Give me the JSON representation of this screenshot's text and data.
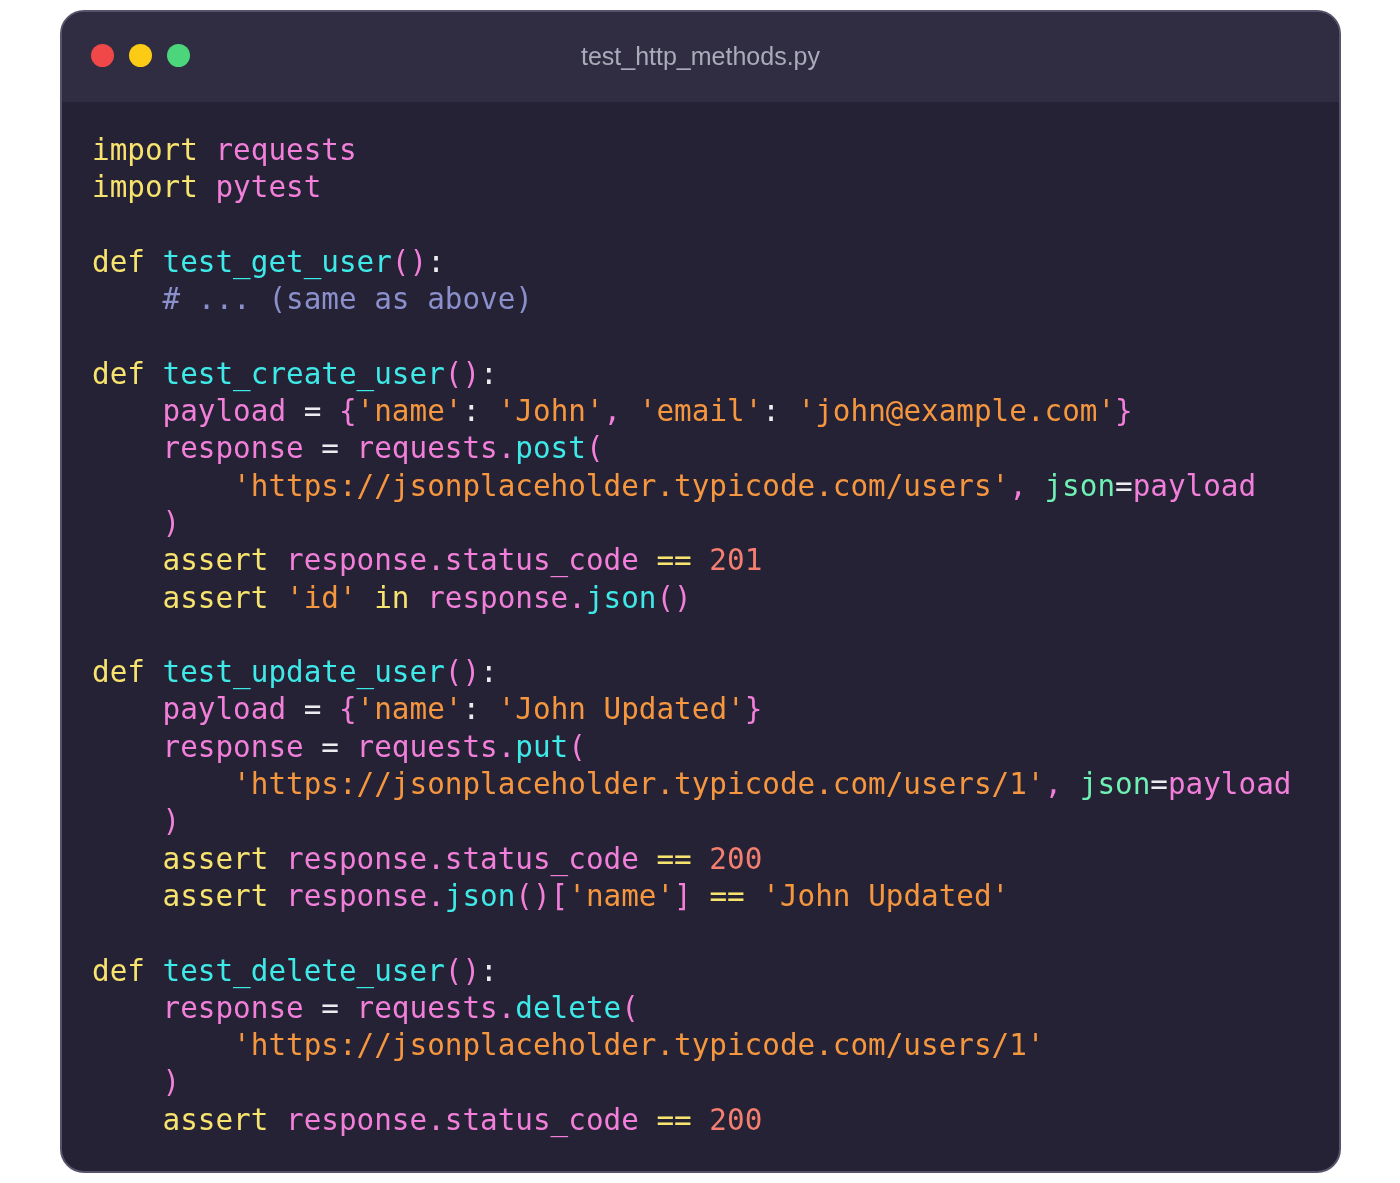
{
  "window": {
    "title": "test_http_methods.py"
  },
  "code_lines": [
    {
      "kind": "code",
      "tokens": [
        {
          "kind": "keyword",
          "text": "import "
        },
        {
          "kind": "ident",
          "text": "requests"
        }
      ]
    },
    {
      "kind": "code",
      "tokens": [
        {
          "kind": "keyword",
          "text": "import "
        },
        {
          "kind": "ident",
          "text": "pytest"
        }
      ]
    },
    {
      "kind": "blank"
    },
    {
      "kind": "code",
      "tokens": [
        {
          "kind": "keyword",
          "text": "def "
        },
        {
          "kind": "func",
          "text": "test_get_user"
        },
        {
          "kind": "paren",
          "text": "()"
        },
        {
          "kind": "punct",
          "text": ":"
        }
      ]
    },
    {
      "kind": "code",
      "tokens": [
        {
          "kind": "comment",
          "text": "    # ... (same as above)"
        }
      ]
    },
    {
      "kind": "blank"
    },
    {
      "kind": "code",
      "tokens": [
        {
          "kind": "keyword",
          "text": "def "
        },
        {
          "kind": "func",
          "text": "test_create_user"
        },
        {
          "kind": "paren",
          "text": "()"
        },
        {
          "kind": "punct",
          "text": ":"
        }
      ]
    },
    {
      "kind": "code",
      "tokens": [
        {
          "kind": "ident",
          "text": "    payload"
        },
        {
          "kind": "punct",
          "text": " = "
        },
        {
          "kind": "paren",
          "text": "{"
        },
        {
          "kind": "string",
          "text": "'name'"
        },
        {
          "kind": "punct",
          "text": ": "
        },
        {
          "kind": "string",
          "text": "'John'"
        },
        {
          "kind": "paren",
          "text": ", "
        },
        {
          "kind": "string",
          "text": "'email'"
        },
        {
          "kind": "punct",
          "text": ": "
        },
        {
          "kind": "string",
          "text": "'john@example.com'"
        },
        {
          "kind": "paren",
          "text": "}"
        }
      ]
    },
    {
      "kind": "code",
      "tokens": [
        {
          "kind": "ident",
          "text": "    response"
        },
        {
          "kind": "punct",
          "text": " = "
        },
        {
          "kind": "ident",
          "text": "requests."
        },
        {
          "kind": "func",
          "text": "post"
        },
        {
          "kind": "paren",
          "text": "("
        }
      ]
    },
    {
      "kind": "code",
      "tokens": [
        {
          "kind": "string",
          "text": "        'https://jsonplaceholder.typicode.com/users'"
        },
        {
          "kind": "paren",
          "text": ", "
        },
        {
          "kind": "param",
          "text": "json"
        },
        {
          "kind": "punct",
          "text": "="
        },
        {
          "kind": "ident",
          "text": "payload"
        }
      ]
    },
    {
      "kind": "code",
      "tokens": [
        {
          "kind": "paren",
          "text": "    )"
        }
      ]
    },
    {
      "kind": "code",
      "tokens": [
        {
          "kind": "keyword",
          "text": "    assert "
        },
        {
          "kind": "ident",
          "text": "response.status_code "
        },
        {
          "kind": "operator",
          "text": "=="
        },
        {
          "kind": "number",
          "text": " 201"
        }
      ]
    },
    {
      "kind": "code",
      "tokens": [
        {
          "kind": "keyword",
          "text": "    assert "
        },
        {
          "kind": "string",
          "text": "'id'"
        },
        {
          "kind": "keyword",
          "text": " in "
        },
        {
          "kind": "ident",
          "text": "response."
        },
        {
          "kind": "func",
          "text": "json"
        },
        {
          "kind": "paren",
          "text": "()"
        }
      ]
    },
    {
      "kind": "blank"
    },
    {
      "kind": "code",
      "tokens": [
        {
          "kind": "keyword",
          "text": "def "
        },
        {
          "kind": "func",
          "text": "test_update_user"
        },
        {
          "kind": "paren",
          "text": "()"
        },
        {
          "kind": "punct",
          "text": ":"
        }
      ]
    },
    {
      "kind": "code",
      "tokens": [
        {
          "kind": "ident",
          "text": "    payload"
        },
        {
          "kind": "punct",
          "text": " = "
        },
        {
          "kind": "paren",
          "text": "{"
        },
        {
          "kind": "string",
          "text": "'name'"
        },
        {
          "kind": "punct",
          "text": ": "
        },
        {
          "kind": "string",
          "text": "'John Updated'"
        },
        {
          "kind": "paren",
          "text": "}"
        }
      ]
    },
    {
      "kind": "code",
      "tokens": [
        {
          "kind": "ident",
          "text": "    response"
        },
        {
          "kind": "punct",
          "text": " = "
        },
        {
          "kind": "ident",
          "text": "requests."
        },
        {
          "kind": "func",
          "text": "put"
        },
        {
          "kind": "paren",
          "text": "("
        }
      ]
    },
    {
      "kind": "code",
      "tokens": [
        {
          "kind": "string",
          "text": "        'https://jsonplaceholder.typicode.com/users/1'"
        },
        {
          "kind": "paren",
          "text": ", "
        },
        {
          "kind": "param",
          "text": "json"
        },
        {
          "kind": "punct",
          "text": "="
        },
        {
          "kind": "ident",
          "text": "payload"
        }
      ]
    },
    {
      "kind": "code",
      "tokens": [
        {
          "kind": "paren",
          "text": "    )"
        }
      ]
    },
    {
      "kind": "code",
      "tokens": [
        {
          "kind": "keyword",
          "text": "    assert "
        },
        {
          "kind": "ident",
          "text": "response.status_code "
        },
        {
          "kind": "operator",
          "text": "=="
        },
        {
          "kind": "number",
          "text": " 200"
        }
      ]
    },
    {
      "kind": "code",
      "tokens": [
        {
          "kind": "keyword",
          "text": "    assert "
        },
        {
          "kind": "ident",
          "text": "response."
        },
        {
          "kind": "func",
          "text": "json"
        },
        {
          "kind": "paren",
          "text": "()["
        },
        {
          "kind": "string",
          "text": "'name'"
        },
        {
          "kind": "paren",
          "text": "] "
        },
        {
          "kind": "operator",
          "text": "=="
        },
        {
          "kind": "string",
          "text": " 'John Updated'"
        }
      ]
    },
    {
      "kind": "blank"
    },
    {
      "kind": "code",
      "tokens": [
        {
          "kind": "keyword",
          "text": "def "
        },
        {
          "kind": "func",
          "text": "test_delete_user"
        },
        {
          "kind": "paren",
          "text": "()"
        },
        {
          "kind": "punct",
          "text": ":"
        }
      ]
    },
    {
      "kind": "code",
      "tokens": [
        {
          "kind": "ident",
          "text": "    response"
        },
        {
          "kind": "punct",
          "text": " = "
        },
        {
          "kind": "ident",
          "text": "requests."
        },
        {
          "kind": "func",
          "text": "delete"
        },
        {
          "kind": "paren",
          "text": "("
        }
      ]
    },
    {
      "kind": "code",
      "tokens": [
        {
          "kind": "string",
          "text": "        'https://jsonplaceholder.typicode.com/users/1'"
        }
      ]
    },
    {
      "kind": "code",
      "tokens": [
        {
          "kind": "paren",
          "text": "    )"
        }
      ]
    },
    {
      "kind": "code",
      "tokens": [
        {
          "kind": "keyword",
          "text": "    assert "
        },
        {
          "kind": "ident",
          "text": "response.status_code "
        },
        {
          "kind": "operator",
          "text": "=="
        },
        {
          "kind": "number",
          "text": " 200"
        }
      ]
    }
  ]
}
